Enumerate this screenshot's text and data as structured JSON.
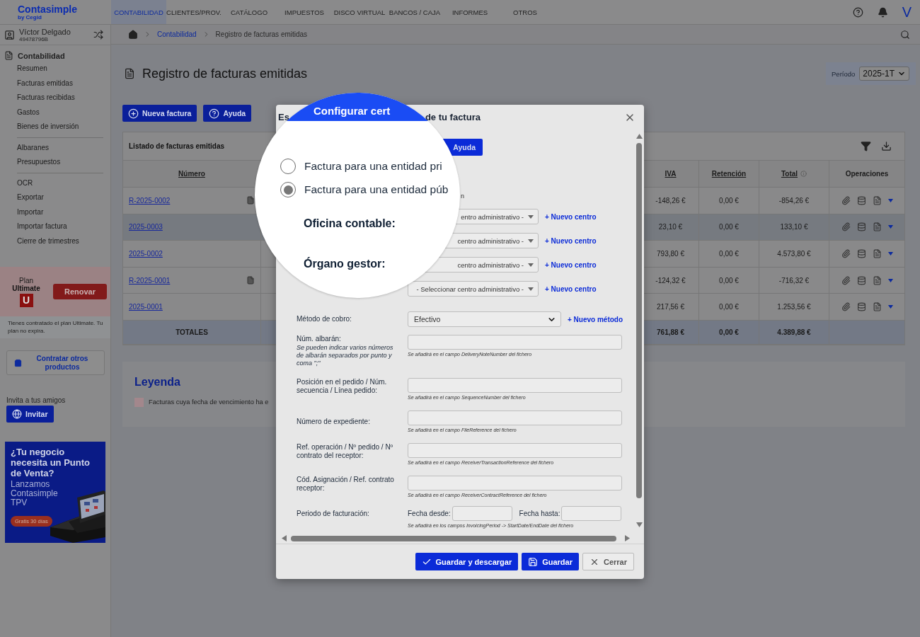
{
  "topbar": {
    "logo": "Contasimple",
    "logo_sub": "by Cegid",
    "avatar": "V",
    "nav": [
      {
        "label": "CONTABILIDAD",
        "selected": true
      },
      {
        "label": "CLIENTES/PROV.",
        "selected": false
      },
      {
        "label": "CATÁLOGO",
        "selected": false
      },
      {
        "label": "IMPUESTOS",
        "selected": false
      },
      {
        "label": "DISCO VIRTUAL",
        "selected": false
      },
      {
        "label": "BANCOS / CAJA",
        "selected": false
      },
      {
        "label": "INFORMES",
        "selected": false
      },
      {
        "label": "OTROS",
        "selected": false
      }
    ]
  },
  "sidebar": {
    "user_name": "Víctor Delgado",
    "user_id": "49478796B",
    "section": "Contabilidad",
    "groups": [
      {
        "items": [
          "Resumen",
          "Facturas emitidas",
          "Facturas recibidas",
          "Gastos",
          "Bienes de inversión"
        ]
      },
      {
        "items": [
          "Albaranes",
          "Presupuestos"
        ]
      },
      {
        "items": [
          "OCR",
          "Exportar",
          "Importar",
          "Importar factura",
          "Cierre de trimestres"
        ]
      }
    ],
    "plan": {
      "label": "Plan",
      "name": "Ultimate",
      "badge": "U",
      "button": "Renovar",
      "note": "Tienes contratado el plan Ultimate. Tu plan no expira."
    },
    "products_button": "Contratar otros productos",
    "invite_label": "Invita a tus amigos",
    "invite_button": "Invitar",
    "ad": {
      "headline": "¿Tu negocio necesita un Punto de Venta?",
      "body": "Lanzamos Contasimple TPV",
      "badge": "Gratis 30 días"
    }
  },
  "breadcrumb": [
    "Contabilidad",
    "Registro de facturas emitidas"
  ],
  "page": {
    "title": "Registro de facturas emitidas",
    "period_label": "Período",
    "period": "2025-1T",
    "buttons": [
      "Nueva factura",
      "Ayuda"
    ]
  },
  "table": {
    "title": "Listado de facturas emitidas",
    "columns": [
      "Número",
      "IVA",
      "Retención",
      "Total",
      "Operaciones"
    ],
    "rows": [
      {
        "number": "R-2025-0002",
        "document": true,
        "iva": "-148,26 €",
        "retencion": "0,00 €",
        "total": "-854,26 €",
        "selected": false
      },
      {
        "number": "2025-0003",
        "document": false,
        "iva": "23,10 €",
        "retencion": "0,00 €",
        "total": "133,10 €",
        "selected": true
      },
      {
        "number": "2025-0002",
        "document": false,
        "iva": "793,80 €",
        "retencion": "0,00 €",
        "total": "4.573,80 €",
        "selected": false
      },
      {
        "number": "R-2025-0001",
        "document": true,
        "iva": "-124,32 €",
        "retencion": "0,00 €",
        "total": "-716,32 €",
        "selected": false
      },
      {
        "number": "2025-0001",
        "document": false,
        "iva": "217,56 €",
        "retencion": "0,00 €",
        "total": "1.253,56 €",
        "selected": false
      }
    ],
    "totals": {
      "label": "TOTALES",
      "iva": "761,88 €",
      "retencion": "0,00 €",
      "total": "4.389,88 €"
    }
  },
  "legend": {
    "title": "Leyenda",
    "items": [
      {
        "label": "Facturas cuya fecha de vencimiento ha e",
        "color": "#a3878c"
      }
    ]
  },
  "modal": {
    "title_start": "Es",
    "title_end": "de tu factura",
    "help_button": "Ayuda",
    "fragment": "n",
    "centers": [
      {
        "value": "entro administrativo -",
        "action": "+ Nuevo centro"
      },
      {
        "value": "centro administrativo -",
        "action": "+ Nuevo centro"
      },
      {
        "value": "centro administrativo -",
        "action": "+ Nuevo centro"
      },
      {
        "value": "- Seleccionar centro administrativo -",
        "action": "+ Nuevo centro"
      }
    ],
    "fields": [
      {
        "kind": "select",
        "label": "Método de cobro:",
        "value": "Efectivo",
        "action": "+ Nuevo método"
      },
      {
        "kind": "text",
        "label": "Núm. albarán:",
        "help": "Se pueden indicar varios números de albarán separados por punto y coma \";\"",
        "hint": "Se añadirá en el campo DeliveryNoteNumber del fichero"
      },
      {
        "kind": "text",
        "label": "Posición en el pedido / Núm. secuencia / Línea pedido:",
        "hint": "Se añadirá en el campo SequenceNumber del fichero"
      },
      {
        "kind": "text",
        "label": "Número de expediente:",
        "hint": "Se añadirá en el campo FileReference del fichero"
      },
      {
        "kind": "text",
        "label": "Ref. operación / Nº pedido / Nº contrato del receptor:",
        "hint": "Se añadirá en el campo ReceiverTransactionReference del fichero"
      },
      {
        "kind": "text",
        "label": "Cód. Asignación / Ref. contrato receptor:",
        "hint": "Se añadirá en el campo ReceiverContractReference del fichero"
      },
      {
        "kind": "period",
        "label": "Periodo de facturación:",
        "from_label": "Fecha desde:",
        "to_label": "Fecha hasta:",
        "hint": "Se añadirá en los campos InvoicingPeriod -> StartDate/EndDate del fichero"
      }
    ],
    "buttons": [
      {
        "kind": "confirm",
        "label": "Guardar y descargar"
      },
      {
        "kind": "save",
        "label": "Guardar"
      },
      {
        "kind": "cancel",
        "label": "Cerrar"
      }
    ]
  },
  "magnifier": {
    "title": "Configurar cert",
    "options": [
      {
        "label": "Factura para una entidad pri",
        "selected": false
      },
      {
        "label": "Factura para una entidad púb",
        "selected": true
      }
    ],
    "labels": [
      "Oficina contable:",
      "Órgano gestor:"
    ]
  }
}
